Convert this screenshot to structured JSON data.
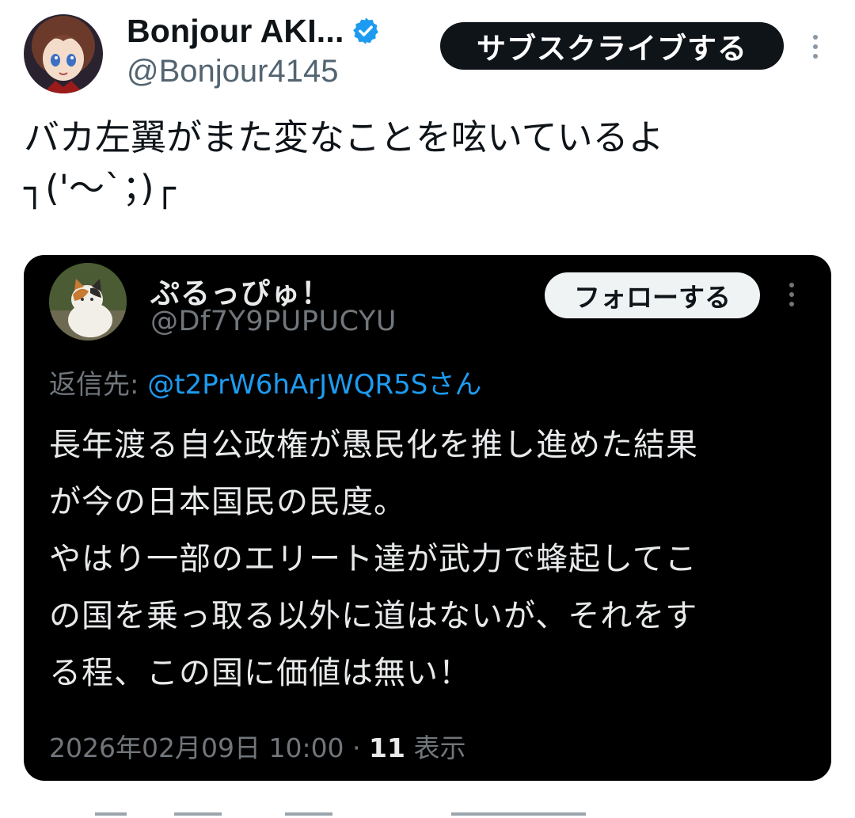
{
  "author": {
    "display_name": "Bonjour AKI...",
    "handle": "@Bonjour4145",
    "verified": true,
    "verified_color": "#1d9bf0"
  },
  "actions": {
    "subscribe_label": "サブスクライブする",
    "more_icon": "more-vertical-icon"
  },
  "tweet": {
    "text": "バカ左翼がまた変なことを呟いているよ\n┐('〜`；)┌"
  },
  "quoted_post": {
    "display_name": "ぷるっぴゅ！",
    "handle": "@Df7Y9PUPUCYU",
    "follow_label": "フォローする",
    "reply_prefix": "返信先: ",
    "reply_target": "@t2PrW6hArJWQR5Sさん",
    "text": "長年渡る自公政権が愚民化を推し進めた結果\nが今の日本国民の民度。\nやはり一部のエリート達が武力で蜂起してこ\nの国を乗っ取る以外に道はないが、それをす\nる程、この国に価値は無い！",
    "timestamp": "2026年02月09日 10:00 · ",
    "views_count": "11",
    "views_label": " 表示",
    "background": "#000000",
    "link_color": "#1d9bf0"
  }
}
